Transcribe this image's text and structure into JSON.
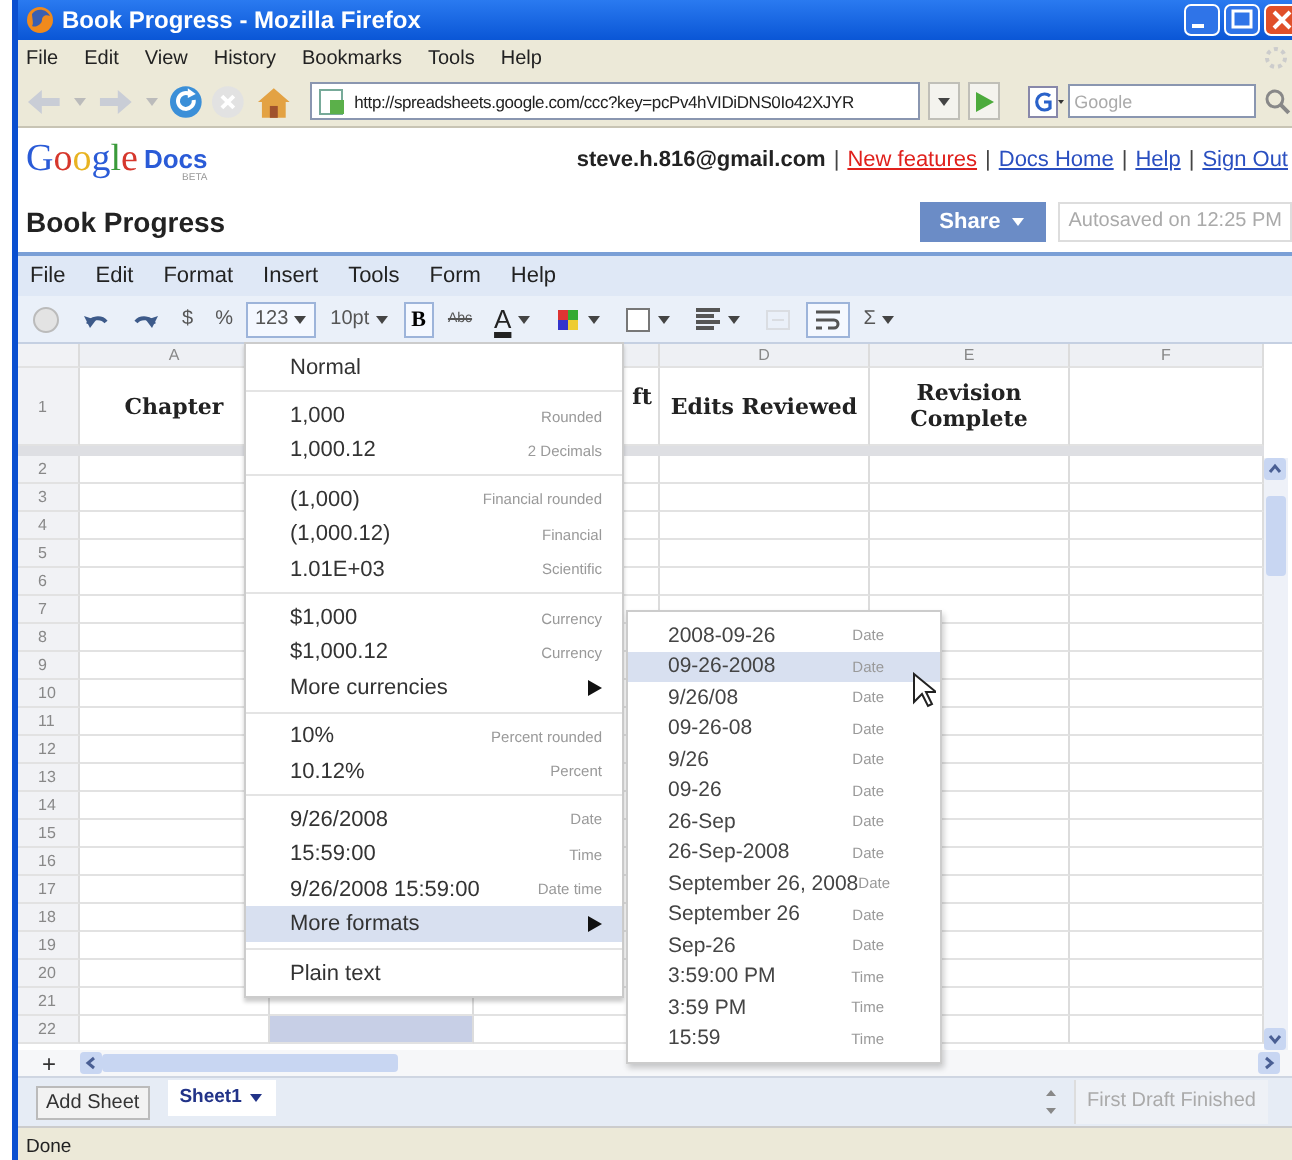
{
  "window": {
    "title": "Book Progress - Mozilla Firefox"
  },
  "browser_menu": [
    "File",
    "Edit",
    "View",
    "History",
    "Bookmarks",
    "Tools",
    "Help"
  ],
  "address_bar": {
    "value": "http://spreadsheets.google.com/ccc?key=pcPv4hVIDiDNS0Io42XJYR"
  },
  "search_field": {
    "placeholder": "Google"
  },
  "docs_header": {
    "logo": "Google",
    "product": "Docs",
    "beta": "BETA",
    "account_items": [
      {
        "kind": "user",
        "text": "steve.h.816@gmail.com"
      },
      {
        "kind": "separator",
        "text": "|"
      },
      {
        "kind": "new",
        "text": "New features"
      },
      {
        "kind": "separator",
        "text": "|"
      },
      {
        "kind": "link",
        "text": "Docs Home"
      },
      {
        "kind": "separator",
        "text": "|"
      },
      {
        "kind": "link",
        "text": "Help"
      },
      {
        "kind": "separator",
        "text": "|"
      },
      {
        "kind": "link",
        "text": "Sign Out"
      }
    ],
    "title": "Book Progress",
    "share_button": "Share",
    "autosave": "Autosaved on 12:25 PM"
  },
  "app_menu": [
    "File",
    "Edit",
    "Format",
    "Insert",
    "Tools",
    "Form",
    "Help"
  ],
  "toolbar": [
    {
      "kind": "print",
      "pressed": false,
      "disabled": false
    },
    {
      "kind": "undo",
      "pressed": false,
      "disabled": false
    },
    {
      "kind": "redo",
      "pressed": false,
      "disabled": false
    },
    {
      "kind": "text",
      "label": "$",
      "pressed": false,
      "disabled": false
    },
    {
      "kind": "text",
      "label": "%",
      "pressed": false,
      "disabled": false
    },
    {
      "kind": "dropdown",
      "label": "123",
      "pressed": true,
      "disabled": false
    },
    {
      "kind": "dropdown",
      "label": "10pt",
      "pressed": false,
      "disabled": false
    },
    {
      "kind": "bold",
      "label": "B",
      "pressed": true,
      "disabled": false
    },
    {
      "kind": "strike",
      "label": "Abc",
      "pressed": false,
      "disabled": false
    },
    {
      "kind": "text-color",
      "label": "A",
      "pressed": false,
      "disabled": false
    },
    {
      "kind": "fill-color",
      "pressed": false,
      "disabled": false
    },
    {
      "kind": "borders",
      "pressed": false,
      "disabled": false
    },
    {
      "kind": "align",
      "pressed": false,
      "disabled": false
    },
    {
      "kind": "merge",
      "pressed": false,
      "disabled": true
    },
    {
      "kind": "wrap",
      "pressed": true,
      "disabled": false
    },
    {
      "kind": "dropdown",
      "label": "Σ",
      "pressed": false,
      "disabled": false
    }
  ],
  "columns": [
    {
      "label": "A",
      "header": "Chapter"
    },
    {},
    {
      "header": "ft"
    },
    {
      "label": "D",
      "header": "Edits Reviewed"
    },
    {
      "label": "E",
      "header": "Revision Complete"
    },
    {
      "label": "F"
    }
  ],
  "rows": [
    {
      "label": "2",
      "selected": false
    },
    {
      "label": "3",
      "selected": false
    },
    {
      "label": "4",
      "selected": false
    },
    {
      "label": "5",
      "selected": false
    },
    {
      "label": "6",
      "selected": false
    },
    {
      "label": "7",
      "selected": false
    },
    {
      "label": "8",
      "selected": false
    },
    {
      "label": "9",
      "selected": false
    },
    {
      "label": "10",
      "selected": false
    },
    {
      "label": "11",
      "selected": false
    },
    {
      "label": "12",
      "selected": false
    },
    {
      "label": "13",
      "selected": false
    },
    {
      "label": "14",
      "selected": false
    },
    {
      "label": "15",
      "selected": false
    },
    {
      "label": "16",
      "selected": false
    },
    {
      "label": "17",
      "selected": false
    },
    {
      "label": "18",
      "selected": false
    },
    {
      "label": "19",
      "selected": false
    },
    {
      "label": "20",
      "selected": false
    },
    {
      "label": "21",
      "selected": false
    },
    {
      "label": "22",
      "selected": true
    }
  ],
  "header_row_number": "1",
  "add_row_button": "+",
  "format_menu": [
    [
      {
        "label": "Normal",
        "submenu": false,
        "highlighted": false
      }
    ],
    [
      {
        "label": "1,000",
        "hint": "Rounded",
        "submenu": false,
        "highlighted": false
      },
      {
        "label": "1,000.12",
        "hint": "2 Decimals",
        "submenu": false,
        "highlighted": false
      }
    ],
    [
      {
        "label": "(1,000)",
        "hint": "Financial rounded",
        "submenu": false,
        "highlighted": false
      },
      {
        "label": "(1,000.12)",
        "hint": "Financial",
        "submenu": false,
        "highlighted": false
      },
      {
        "label": "1.01E+03",
        "hint": "Scientific",
        "submenu": false,
        "highlighted": false
      }
    ],
    [
      {
        "label": "$1,000",
        "hint": "Currency",
        "submenu": false,
        "highlighted": false
      },
      {
        "label": "$1,000.12",
        "hint": "Currency",
        "submenu": false,
        "highlighted": false
      },
      {
        "label": "More currencies",
        "submenu": true,
        "highlighted": false
      }
    ],
    [
      {
        "label": "10%",
        "hint": "Percent rounded",
        "submenu": false,
        "highlighted": false
      },
      {
        "label": "10.12%",
        "hint": "Percent",
        "submenu": false,
        "highlighted": false
      }
    ],
    [
      {
        "label": "9/26/2008",
        "hint": "Date",
        "submenu": false,
        "highlighted": false
      },
      {
        "label": "15:59:00",
        "hint": "Time",
        "submenu": false,
        "highlighted": false
      },
      {
        "label": "9/26/2008 15:59:00",
        "hint": "Date time",
        "submenu": false,
        "highlighted": false
      },
      {
        "label": "More formats",
        "submenu": true,
        "highlighted": true
      }
    ],
    [
      {
        "label": "Plain text",
        "submenu": false,
        "highlighted": false
      }
    ]
  ],
  "more_formats_menu": [
    {
      "label": "2008-09-26",
      "hint": "Date",
      "highlighted": false
    },
    {
      "label": "09-26-2008",
      "hint": "Date",
      "highlighted": true
    },
    {
      "label": "9/26/08",
      "hint": "Date",
      "highlighted": false
    },
    {
      "label": "09-26-08",
      "hint": "Date",
      "highlighted": false
    },
    {
      "label": "9/26",
      "hint": "Date",
      "highlighted": false
    },
    {
      "label": "09-26",
      "hint": "Date",
      "highlighted": false
    },
    {
      "label": "26-Sep",
      "hint": "Date",
      "highlighted": false
    },
    {
      "label": "26-Sep-2008",
      "hint": "Date",
      "highlighted": false
    },
    {
      "label": "September 26, 2008",
      "hint": "Date",
      "highlighted": false
    },
    {
      "label": "September 26",
      "hint": "Date",
      "highlighted": false
    },
    {
      "label": "Sep-26",
      "hint": "Date",
      "highlighted": false
    },
    {
      "label": "3:59:00 PM",
      "hint": "Time",
      "highlighted": false
    },
    {
      "label": "3:59 PM",
      "hint": "Time",
      "highlighted": false
    },
    {
      "label": "15:59",
      "hint": "Time",
      "highlighted": false
    }
  ],
  "sheet_bar": {
    "add_button": "Add Sheet",
    "tabs": [
      {
        "label": "Sheet1",
        "selected": true
      }
    ],
    "range_field": {
      "value": "First Draft Finished",
      "disabled": true
    }
  },
  "status_bar": "Done"
}
